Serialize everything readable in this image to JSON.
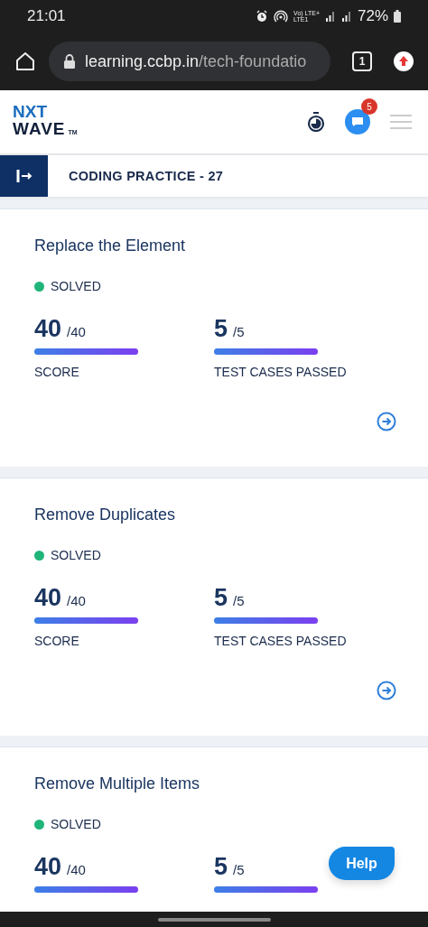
{
  "status_bar": {
    "time": "21:01",
    "network_top": "Vo) LTE+",
    "network_bottom": "LTE1",
    "battery": "72%"
  },
  "browser": {
    "url_host": "learning.ccbp.in",
    "url_path": "/tech-foundatio",
    "tab_count": "1"
  },
  "header": {
    "logo_top": "NXT",
    "logo_bottom": "WAVE",
    "logo_mark": "TM",
    "notification_count": "5"
  },
  "title_bar": {
    "title": "CODING PRACTICE - 27"
  },
  "cards": [
    {
      "title": "Replace the Element",
      "status": {
        "label": "SOLVED",
        "color": "#1fb47a"
      },
      "score": {
        "value": "40",
        "total": "/40",
        "level": 1,
        "label": "SCORE"
      },
      "tests": {
        "value": "5",
        "total": "/5",
        "level": 1,
        "label": "TEST CASES PASSED"
      }
    },
    {
      "title": "Remove Duplicates",
      "status": {
        "label": "SOLVED",
        "color": "#1fb47a"
      },
      "score": {
        "value": "40",
        "total": "/40",
        "level": 1,
        "label": "SCORE"
      },
      "tests": {
        "value": "5",
        "total": "/5",
        "level": 1,
        "label": "TEST CASES PASSED"
      }
    },
    {
      "title": "Remove Multiple Items",
      "status": {
        "label": "SOLVED",
        "color": "#1fb47a"
      },
      "score": {
        "value": "40",
        "total": "/40",
        "level": 1
      },
      "tests": {
        "value": "5",
        "total": "/5",
        "level": 1
      }
    }
  ],
  "help_button": {
    "label": "Help"
  }
}
